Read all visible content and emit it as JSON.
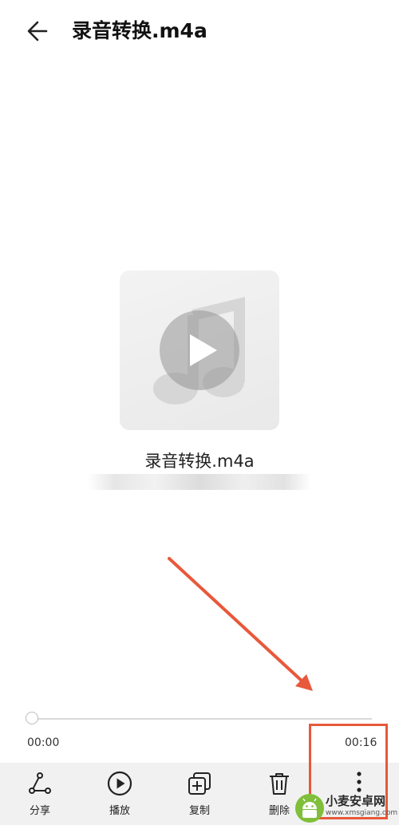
{
  "header": {
    "back_icon": "arrow-left-icon",
    "title": "录音转换.m4a"
  },
  "album_art": {
    "note_icon": "music-note-icon",
    "play_icon": "play-icon"
  },
  "file": {
    "name": "录音转换.m4a",
    "meta": ""
  },
  "player": {
    "current_time": "00:00",
    "total_time": "00:16",
    "progress": 0.0
  },
  "toolbar": {
    "items": [
      {
        "label": "分享",
        "icon": "share-icon"
      },
      {
        "label": "播放",
        "icon": "play-circle-icon"
      },
      {
        "label": "复制",
        "icon": "copy-icon"
      },
      {
        "label": "删除",
        "icon": "delete-icon"
      }
    ],
    "more_icon": "more-vertical-icon"
  },
  "annotation": {
    "color": "#e8583b"
  },
  "watermark": {
    "text": "小麦安卓网",
    "url": "www.xmsgiang.com"
  }
}
